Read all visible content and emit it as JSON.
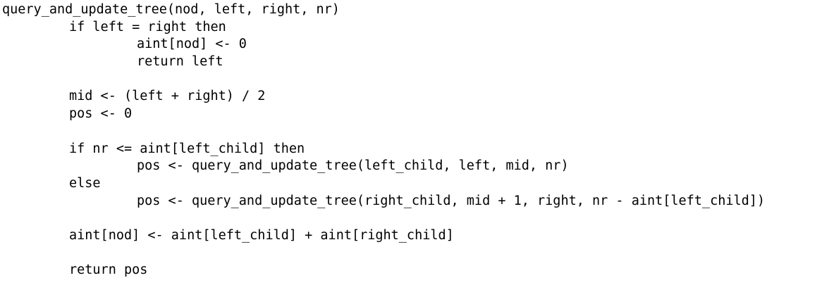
{
  "code": {
    "lines": [
      "query_and_update_tree(nod, left, right, nr)",
      "if left = right then",
      "aint[nod] <- 0",
      "return left",
      "",
      "mid <- (left + right) / 2",
      "pos <- 0",
      "",
      "if nr <= aint[left_child] then",
      "pos <- query_and_update_tree(left_child, left, mid, nr)",
      "else",
      "pos <- query_and_update_tree(right_child, mid + 1, right, nr - aint[left_child])",
      "",
      "aint[nod] <- aint[left_child] + aint[right_child]",
      "",
      "return pos"
    ]
  }
}
